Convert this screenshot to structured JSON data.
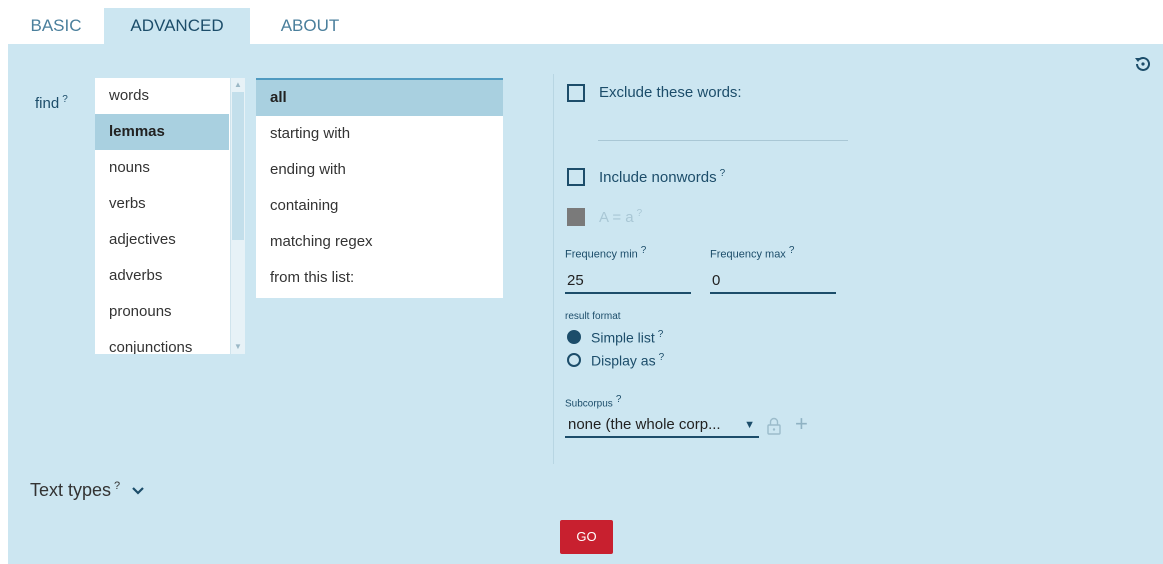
{
  "tabs": {
    "basic": "BASIC",
    "advanced": "ADVANCED",
    "about": "ABOUT"
  },
  "find": {
    "label": "find",
    "help": "?",
    "items": [
      "words",
      "lemmas",
      "nouns",
      "verbs",
      "adjectives",
      "adverbs",
      "pronouns",
      "conjunctions"
    ],
    "selected": "lemmas"
  },
  "match": {
    "items": [
      "all",
      "starting with",
      "ending with",
      "containing",
      "matching regex",
      "from this list:"
    ],
    "selected": "all"
  },
  "options": {
    "exclude_label": "Exclude these words:",
    "nonwords_label": "Include nonwords",
    "case_label": "A = a",
    "help": "?"
  },
  "frequency": {
    "min_label": "Frequency min",
    "max_label": "Frequency max",
    "min_value": "25",
    "max_value": "0"
  },
  "result_format": {
    "label": "result format",
    "simple": "Simple list",
    "display": "Display as",
    "selected": "simple"
  },
  "subcorpus": {
    "label": "Subcorpus",
    "value": "none (the whole corp..."
  },
  "text_types": {
    "label": "Text types"
  },
  "go": {
    "label": "GO"
  },
  "colors": {
    "panel": "#cce6f1",
    "accent": "#1c4d6a",
    "go": "#c8202f",
    "selected": "#a9d0e0"
  },
  "icons": {
    "reset": "reset-icon",
    "lock": "lock-icon",
    "plus": "plus-icon",
    "chevron": "chevron-down-icon",
    "caret": "caret-down-icon"
  }
}
